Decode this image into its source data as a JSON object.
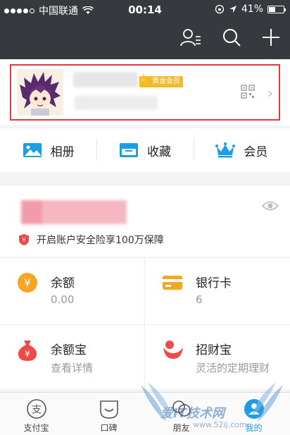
{
  "status": {
    "carrier": "中国联通",
    "time": "00:14",
    "battery": "41%"
  },
  "nav": {
    "icons": [
      "contacts-icon",
      "search-icon",
      "add-icon"
    ]
  },
  "profile": {
    "badge": "黄金会员"
  },
  "quick": {
    "items": [
      {
        "label": "相册",
        "icon": "album-icon"
      },
      {
        "label": "收藏",
        "icon": "favorites-icon"
      },
      {
        "label": "会员",
        "icon": "crown-icon"
      }
    ]
  },
  "account": {
    "insurance_text": "开启账户安全险享100万保障"
  },
  "grid": {
    "items": [
      {
        "title": "余额",
        "sub": "0.00",
        "icon": "balance-icon"
      },
      {
        "title": "银行卡",
        "sub": "6",
        "icon": "bank-card-icon"
      },
      {
        "title": "余额宝",
        "sub": "查看详情",
        "icon": "yuebao-icon"
      },
      {
        "title": "招财宝",
        "sub": "灵活的定期理财",
        "icon": "zhaocaibao-icon"
      }
    ]
  },
  "tabs": [
    {
      "label": "支付宝",
      "icon": "alipay-icon"
    },
    {
      "label": "口碑",
      "icon": "koubei-icon"
    },
    {
      "label": "朋友",
      "icon": "friends-icon"
    },
    {
      "label": "我的",
      "icon": "me-icon"
    }
  ],
  "watermark": {
    "text": "爱IT技术网",
    "url": "www.52ij.com"
  },
  "colors": {
    "header_bg": "#36393e",
    "accent_blue": "#1e9de6",
    "highlight_red": "#e0393e",
    "gold_badge": "#f2b92a"
  }
}
